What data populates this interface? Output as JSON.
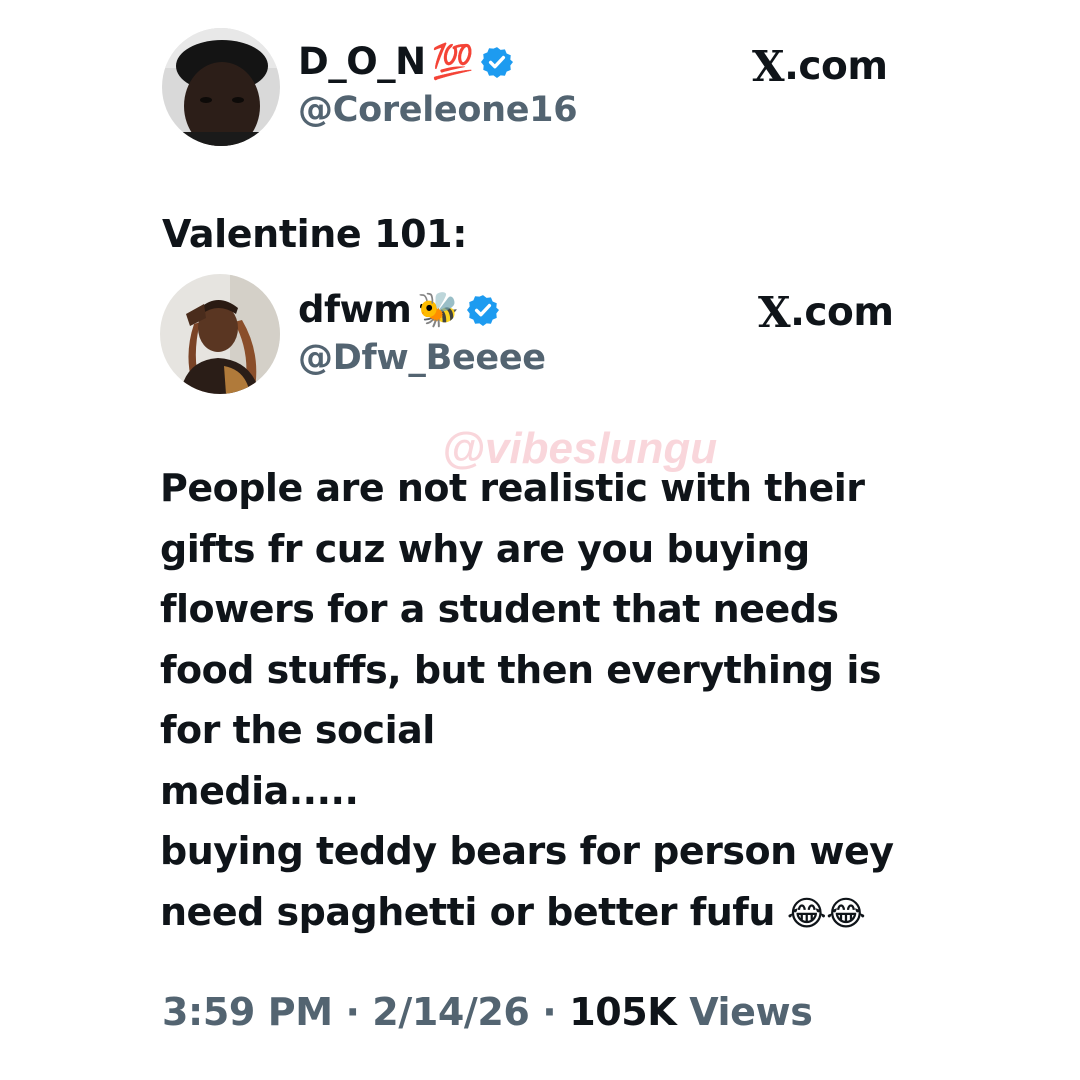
{
  "quoting_tweet": {
    "author": {
      "display_name": "D_O_N",
      "name_badge_emoji": "💯",
      "handle": "@Coreleone16",
      "verified": true
    },
    "brand": "X.com",
    "text": "Valentine 101:"
  },
  "quoted_tweet": {
    "author": {
      "display_name": "dfwm",
      "name_badge_emoji": "🐝",
      "handle": "@Dfw_Beeee",
      "verified": true
    },
    "brand": "X.com",
    "text_lines": [
      "People are not realistic with their",
      "gifts fr cuz why are you buying",
      "flowers for a student that needs",
      "food stuffs, but then everything is",
      "for the social",
      "media.....",
      "buying teddy bears for person wey",
      "need spaghetti or better fufu"
    ],
    "trailing_emojis": "😂😂",
    "timestamp": "3:59 PM · 2/14/26 ·",
    "views_count": "105K",
    "views_label": "Views"
  },
  "watermark": "@vibeslungu",
  "colors": {
    "text_primary": "#0f1419",
    "text_secondary": "#536471",
    "verified_blue": "#1d9bf0",
    "watermark_pink": "#eb7887"
  },
  "icons": {
    "verified": "verified-badge-icon",
    "x_logo": "x-logo-icon"
  }
}
